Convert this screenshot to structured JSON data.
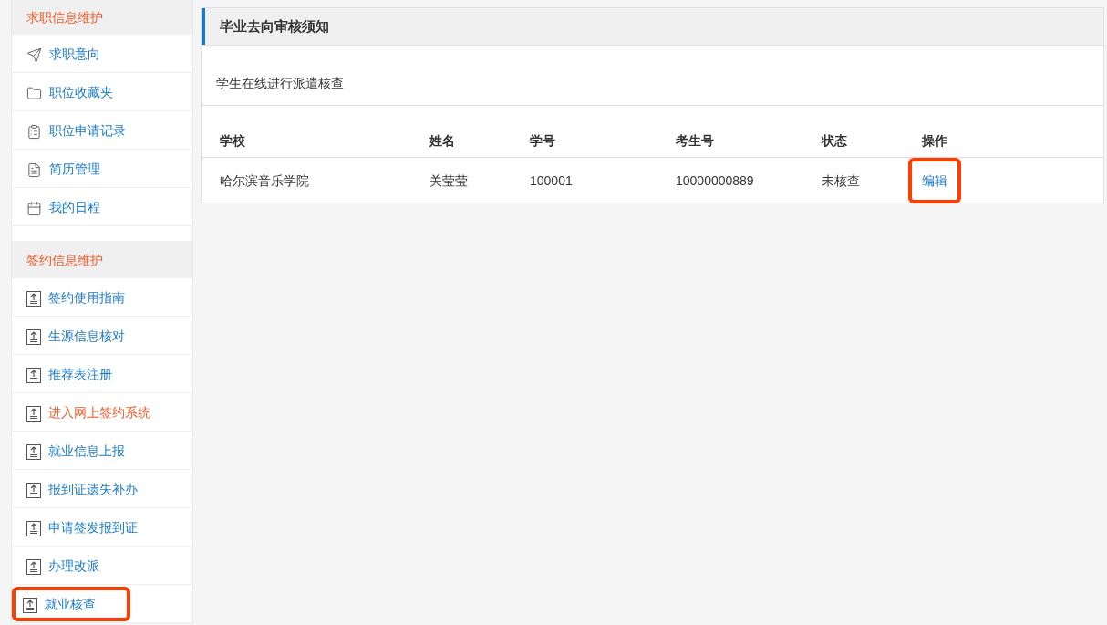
{
  "sidebar": {
    "sections": [
      {
        "title": "求职信息维护",
        "items": [
          {
            "label": "求职意向",
            "kind": "plane",
            "emphasized": false,
            "highlighted": false
          },
          {
            "label": "职位收藏夹",
            "kind": "folder",
            "emphasized": false,
            "highlighted": false
          },
          {
            "label": "职位申请记录",
            "kind": "clipboard",
            "emphasized": false,
            "highlighted": false
          },
          {
            "label": "简历管理",
            "kind": "resume",
            "emphasized": false,
            "highlighted": false
          },
          {
            "label": "我的日程",
            "kind": "calendar",
            "emphasized": false,
            "highlighted": false
          }
        ]
      },
      {
        "title": "签约信息维护",
        "items": [
          {
            "label": "签约使用指南",
            "kind": "upload",
            "emphasized": false,
            "highlighted": false
          },
          {
            "label": "生源信息核对",
            "kind": "upload",
            "emphasized": false,
            "highlighted": false
          },
          {
            "label": "推荐表注册",
            "kind": "upload",
            "emphasized": false,
            "highlighted": false
          },
          {
            "label": "进入网上签约系统",
            "kind": "upload",
            "emphasized": true,
            "highlighted": false
          },
          {
            "label": "就业信息上报",
            "kind": "upload",
            "emphasized": false,
            "highlighted": false
          },
          {
            "label": "报到证遗失补办",
            "kind": "upload",
            "emphasized": false,
            "highlighted": false
          },
          {
            "label": "申请签发报到证",
            "kind": "upload",
            "emphasized": false,
            "highlighted": false
          },
          {
            "label": "办理改派",
            "kind": "upload",
            "emphasized": false,
            "highlighted": false
          },
          {
            "label": "就业核查",
            "kind": "upload",
            "emphasized": false,
            "highlighted": true
          }
        ]
      }
    ]
  },
  "panel": {
    "title": "毕业去向审核须知",
    "description": "学生在线进行派遣核查",
    "table": {
      "columns": [
        "学校",
        "姓名",
        "学号",
        "考生号",
        "状态",
        "操作"
      ],
      "rows": [
        {
          "cells": [
            "哈尔滨音乐学院",
            "关莹莹",
            "100001",
            "10000000889",
            "未核查"
          ],
          "action": {
            "label": "编辑",
            "highlighted": true
          }
        }
      ]
    }
  }
}
